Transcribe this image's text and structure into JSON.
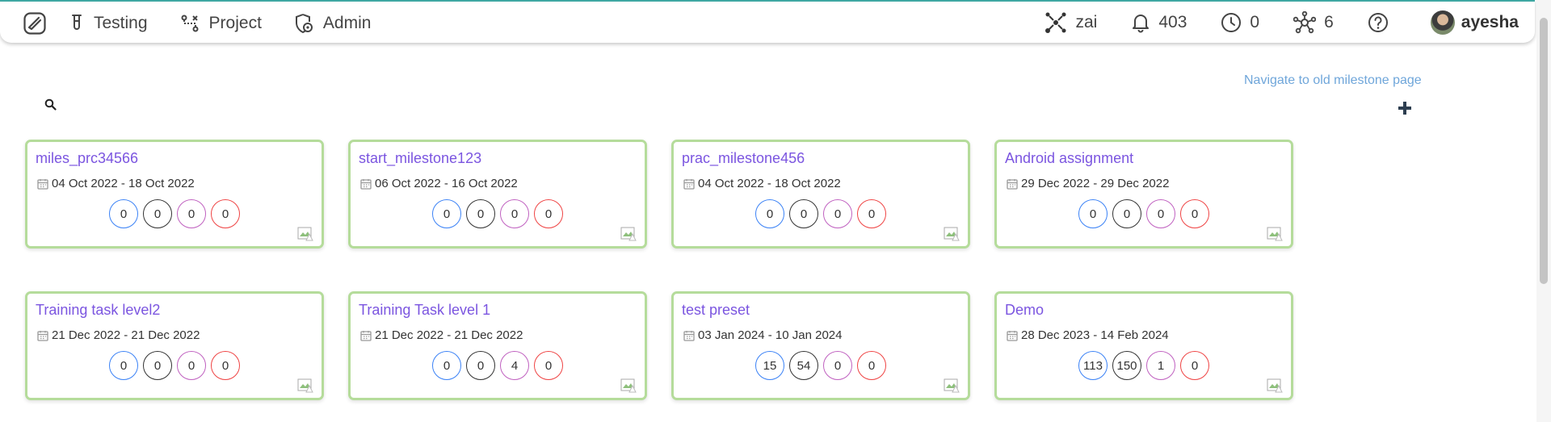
{
  "nav": {
    "testing_label": "Testing",
    "project_label": "Project",
    "admin_label": "Admin"
  },
  "header": {
    "workspace_label": "zai",
    "notifications_count": "403",
    "pending_count": "0",
    "integrations_count": "6",
    "username": "ayesha"
  },
  "page": {
    "old_milestone_link": "Navigate to old milestone page"
  },
  "count_colors": [
    "#3b82f6",
    "#333333",
    "#c061c0",
    "#ef4444"
  ],
  "milestones": [
    {
      "title": "miles_prc34566",
      "dates": "04 Oct 2022 - 18 Oct 2022",
      "counts": [
        "0",
        "0",
        "0",
        "0"
      ]
    },
    {
      "title": "start_milestone123",
      "dates": "06 Oct 2022 - 16 Oct 2022",
      "counts": [
        "0",
        "0",
        "0",
        "0"
      ]
    },
    {
      "title": "prac_milestone456",
      "dates": "04 Oct 2022 - 18 Oct 2022",
      "counts": [
        "0",
        "0",
        "0",
        "0"
      ]
    },
    {
      "title": "Android assignment",
      "dates": "29 Dec 2022 - 29 Dec 2022",
      "counts": [
        "0",
        "0",
        "0",
        "0"
      ]
    },
    {
      "title": "Training task level2",
      "dates": "21 Dec 2022 - 21 Dec 2022",
      "counts": [
        "0",
        "0",
        "0",
        "0"
      ]
    },
    {
      "title": "Training Task level 1",
      "dates": "21 Dec 2022 - 21 Dec 2022",
      "counts": [
        "0",
        "0",
        "4",
        "0"
      ]
    },
    {
      "title": "test preset",
      "dates": "03 Jan 2024 - 10 Jan 2024",
      "counts": [
        "15",
        "54",
        "0",
        "0"
      ]
    },
    {
      "title": "Demo",
      "dates": "28 Dec 2023 - 14 Feb 2024",
      "counts": [
        "113",
        "150",
        "1",
        "0"
      ]
    }
  ]
}
